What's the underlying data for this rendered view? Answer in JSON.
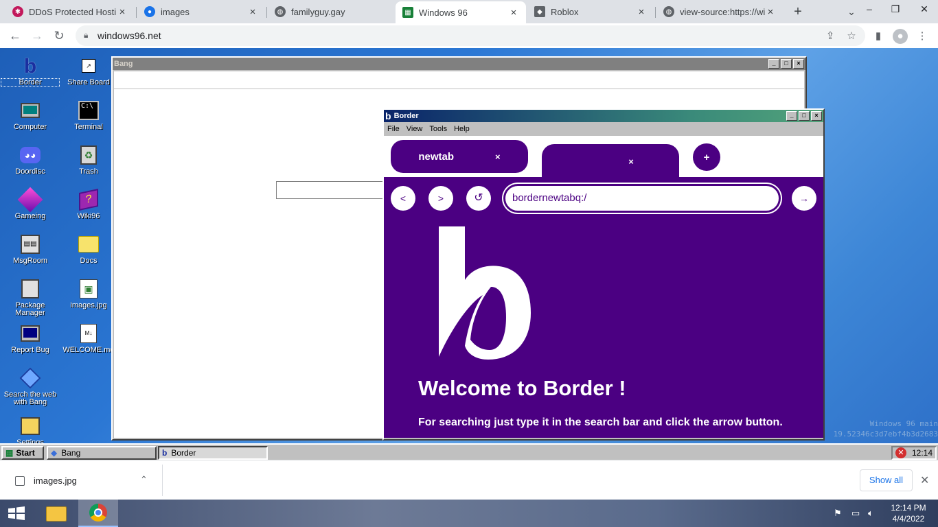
{
  "browser": {
    "tabs": [
      {
        "title": "DDoS Protected Hostin",
        "favicon": "gear-icon",
        "color": "#c2185b"
      },
      {
        "title": "images",
        "favicon": "eye-icon",
        "color": "#1a73e8"
      },
      {
        "title": "familyguy.gay",
        "favicon": "globe-icon",
        "color": "#5f6368"
      },
      {
        "title": "Windows 96",
        "favicon": "windows96-icon",
        "color": "#188038"
      },
      {
        "title": "Roblox",
        "favicon": "roblox-icon",
        "color": "#5f6368"
      },
      {
        "title": "view-source:https://win",
        "favicon": "globe-icon",
        "color": "#5f6368"
      }
    ],
    "active_tab_index": 3,
    "url": "windows96.net",
    "new_tab_label": "+"
  },
  "desktop": {
    "icons_left": [
      {
        "label": "Border",
        "icon": "border-b-icon"
      },
      {
        "label": "Computer",
        "icon": "computer-icon"
      },
      {
        "label": "Doordisc",
        "icon": "discord-icon"
      },
      {
        "label": "Gameing",
        "icon": "cube-icon"
      },
      {
        "label": "MsgRoom",
        "icon": "msgroom-icon"
      },
      {
        "label": "Package Manager",
        "icon": "package-icon"
      },
      {
        "label": "Report Bug",
        "icon": "monitor-icon"
      },
      {
        "label": "Search the web with Bang",
        "icon": "diamond-icon"
      },
      {
        "label": "Settings",
        "icon": "settings-icon"
      }
    ],
    "icons_right": [
      {
        "label": "Share Board",
        "icon": "share-icon"
      },
      {
        "label": "Terminal",
        "icon": "terminal-icon"
      },
      {
        "label": "Trash",
        "icon": "trash-icon"
      },
      {
        "label": "Wiki96",
        "icon": "book-icon"
      },
      {
        "label": "Docs",
        "icon": "folder-icon"
      },
      {
        "label": "images.jpg",
        "icon": "image-file-icon"
      },
      {
        "label": "WELCOME.md",
        "icon": "markdown-file-icon"
      }
    ],
    "watermark_line1": "Windows 96 main",
    "watermark_line2": "19.52346c3d7ebf4b3d2683"
  },
  "bang_window": {
    "title": "Bang"
  },
  "border_window": {
    "title": "Border",
    "menu": [
      "File",
      "View",
      "Tools",
      "Help"
    ],
    "tabs": [
      {
        "label": "newtab",
        "close": "×"
      },
      {
        "label": "",
        "close": "×"
      }
    ],
    "add_tab": "+",
    "nav": {
      "back": "<",
      "forward": ">",
      "reload": "↺",
      "go": "→"
    },
    "address": "bordernewtabq:/",
    "address_selected": "/",
    "welcome": "Welcome to Border !",
    "instructions": "For searching just type it in the search bar and click the arrow button.",
    "colors": {
      "accent": "#4b0082",
      "text": "#ffffff"
    }
  },
  "taskbar96": {
    "start": "Start",
    "items": [
      {
        "label": "Bang",
        "icon": "diamond-icon"
      },
      {
        "label": "Border",
        "icon": "border-b-icon"
      }
    ],
    "clock": "12:14"
  },
  "downloads": {
    "file": "images.jpg",
    "show_all": "Show all"
  },
  "os_taskbar": {
    "time": "12:14 PM",
    "date": "4/4/2022"
  }
}
